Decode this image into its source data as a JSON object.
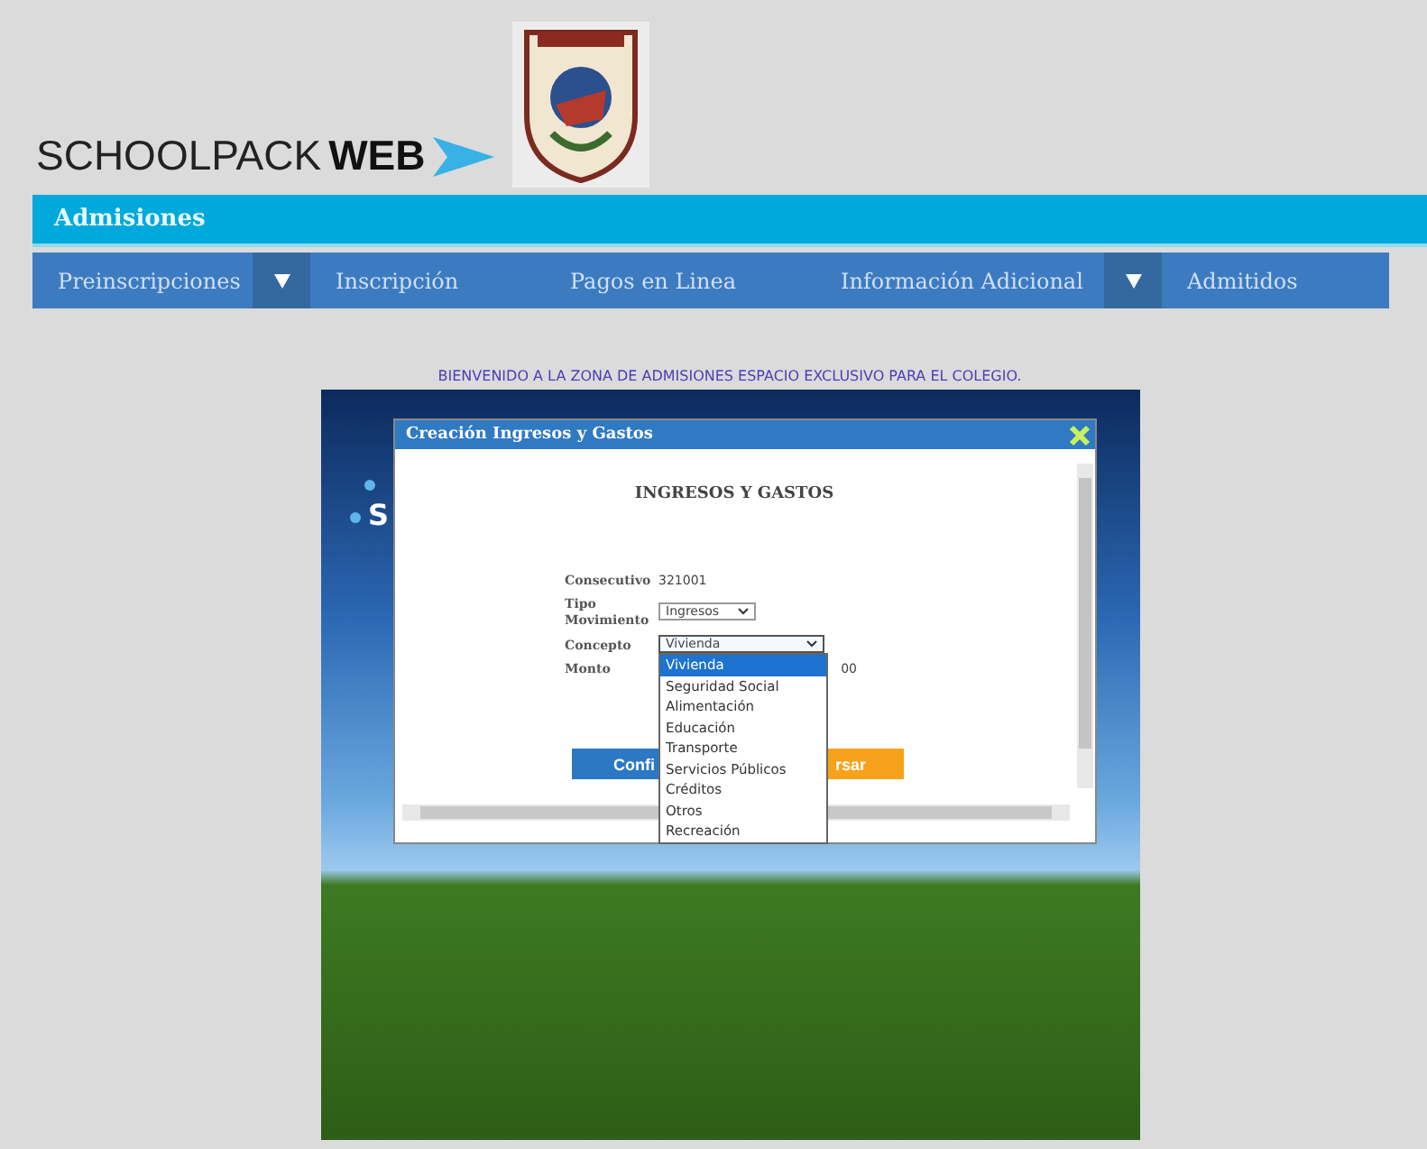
{
  "header": {
    "logo_text": "SCHOOLPACK",
    "logo_bold": "WEB"
  },
  "section_bar": {
    "title": "Admisiones"
  },
  "nav": [
    {
      "label": "Preinscripciones",
      "dropdown": true
    },
    {
      "label": "Inscripción",
      "dropdown": false
    },
    {
      "label": "Pagos en Linea",
      "dropdown": false
    },
    {
      "label": "Información Adicional",
      "dropdown": true
    },
    {
      "label": "Admitidos",
      "dropdown": false
    }
  ],
  "welcome": "BIENVENIDO A LA ZONA DE ADMISIONES ESPACIO EXCLUSIVO PARA EL COLEGIO.",
  "banner": {
    "text": "S"
  },
  "dialog": {
    "title": "Creación Ingresos y Gastos",
    "heading": "INGRESOS Y GASTOS",
    "fields": [
      {
        "label": "Consecutivo",
        "kind": "text",
        "value": "321001"
      },
      {
        "label": "Tipo Movimiento",
        "kind": "select",
        "value": "Ingresos",
        "open": false
      },
      {
        "label": "Concepto",
        "kind": "select",
        "value": "Vivienda",
        "open": true
      },
      {
        "label": "Monto",
        "kind": "text",
        "value": "00"
      }
    ],
    "buttons": [
      {
        "label": "Confi",
        "kind": "primary"
      },
      {
        "label": "rsar",
        "kind": "secondary"
      }
    ],
    "dropdown_options": [
      {
        "label": "Vivienda",
        "selected": true
      },
      {
        "label": "Seguridad Social",
        "selected": false
      },
      {
        "label": "Alimentación",
        "selected": false
      },
      {
        "label": "Educación",
        "selected": false
      },
      {
        "label": "Transporte",
        "selected": false
      },
      {
        "label": "Servicios Públicos",
        "selected": false
      },
      {
        "label": "Créditos",
        "selected": false
      },
      {
        "label": "Otros",
        "selected": false
      },
      {
        "label": "Recreación",
        "selected": false
      }
    ]
  }
}
